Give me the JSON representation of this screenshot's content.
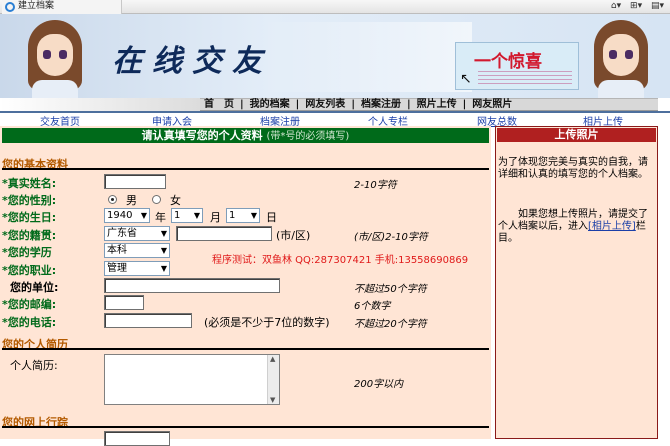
{
  "browser": {
    "tab_title": "建立档案",
    "tool_icons": [
      "home-icon",
      "feeds-icon",
      "print-icon"
    ]
  },
  "banner": {
    "title": "在线交友",
    "promo": "一个惊喜"
  },
  "nav": {
    "items": [
      "首　页",
      "我的档案",
      "网友列表",
      "档案注册",
      "照片上传",
      "网友照片"
    ],
    "separator": "|"
  },
  "sublinks": [
    "交友首页",
    "申请入会",
    "档案注册",
    "个人专栏",
    "网友总数",
    "相片上传"
  ],
  "form": {
    "header": "请认真填写您的个人资料",
    "header_note": "(带*号的必须填写)",
    "section_basic": "您的基本资料",
    "fields": {
      "name_label": "*真实姓名:",
      "name_hint": "2-10字符",
      "gender_label": "*您的性别:",
      "gender_male": "男",
      "gender_female": "女",
      "birth_label": "*您的生日:",
      "birth_year": "1940",
      "year_unit": "年",
      "birth_month": "1",
      "month_unit": "月",
      "birth_day": "1",
      "day_unit": "日",
      "native_label": "*您的籍贯:",
      "province": "广东省",
      "city_unit": "(市/区)",
      "native_hint": "(市/区)2-10字符",
      "edu_label": "*您的学历",
      "edu_value": "本科",
      "job_label": "*您的职业:",
      "job_value": "管理",
      "unit_label": "您的单位:",
      "unit_hint": "不超过50个字符",
      "zip_label": "*您的邮编:",
      "zip_hint": "6个数字",
      "phone_label": "*您的电话:",
      "phone_note": "(必须是不少于7位的数字)",
      "phone_hint": "不超过20个字符"
    },
    "promo_text": "程序测试：双鱼林  QQ:287307421  手机:13558690869",
    "section_resume": "您的个人简历",
    "resume_label": "个人简历:",
    "resume_hint": "200字以内",
    "section_online": "您的网上行踪"
  },
  "side": {
    "header": "上传照片",
    "para1": "为了体现您完美与真实的自我，请详细和认真的填写您的个人档案。",
    "para2_pre": "　　如果您想上传照片，请提交了个人档案以后，进入",
    "para2_link": "[相片上传]",
    "para2_post": "栏目。"
  },
  "colors": {
    "green": "#006a1a",
    "peach": "#ffe5d5",
    "red": "#b02020",
    "orange": "#b35a00",
    "link": "#1b3fa8"
  }
}
